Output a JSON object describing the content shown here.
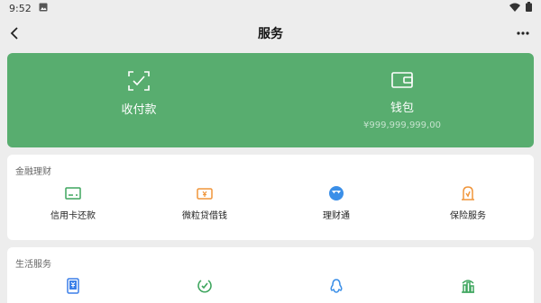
{
  "status_bar": {
    "time": "9:52"
  },
  "header": {
    "title": "服务"
  },
  "wallet_card": {
    "bg_color": "#58ad6f",
    "pay": {
      "label": "收付款",
      "icon": "scan-pay-icon"
    },
    "wallet": {
      "label": "钱包",
      "balance": "¥999,999,999,00",
      "icon": "wallet-icon"
    }
  },
  "finance": {
    "title": "金融理财",
    "items": [
      {
        "label": "信用卡还款",
        "icon": "credit-card-icon",
        "color": "#3fa65f"
      },
      {
        "label": "微粒贷借钱",
        "icon": "loan-icon",
        "color": "#f0953a"
      },
      {
        "label": "理财通",
        "icon": "wealth-icon",
        "color": "#3b8fe8"
      },
      {
        "label": "保险服务",
        "icon": "insurance-icon",
        "color": "#f0953a"
      }
    ]
  },
  "life": {
    "title": "生活服务",
    "items": [
      {
        "label": "",
        "icon": "phone-recharge-icon",
        "color": "#3b7fe8"
      },
      {
        "label": "",
        "icon": "utilities-icon",
        "color": "#3fa65f"
      },
      {
        "label": "",
        "icon": "qq-icon",
        "color": "#3b8fe8"
      },
      {
        "label": "",
        "icon": "city-service-icon",
        "color": "#3fa65f"
      }
    ]
  }
}
